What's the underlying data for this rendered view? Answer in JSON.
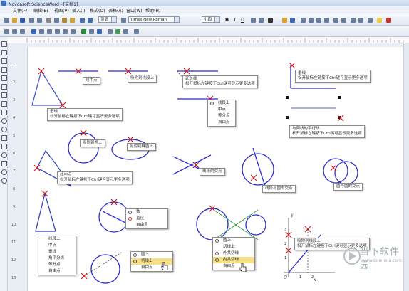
{
  "window": {
    "title": "Novoasoft ScienceWord - [文档1]"
  },
  "menubar": {
    "items": [
      "文件(F)",
      "编辑(E)",
      "视图(V)",
      "插入(I)",
      "格式(O)",
      "表格(A)",
      "窗口(W)",
      "帮助(H)"
    ]
  },
  "toolbar": {
    "style_combo": "页眉",
    "font_combo": "Times New Roman",
    "size_combo": "小四",
    "bold": "B",
    "italic": "I",
    "underline": "U"
  },
  "tooltips": {
    "line_midpoint": "线中点",
    "snap_to_line": "吸附到线段上",
    "extend_line": "延长线",
    "extend_line_hint": "松开鼠标左键按下Ctrl键可显示更多选项",
    "perpendicular": "垂线",
    "perpendicular_hint": "松开鼠标左键按下Ctrl键可显示更多选项",
    "vertical": "垂线",
    "vertical_hint": "松开鼠标左键按下Ctrl键可显示更多选项",
    "parallel": "与两线的平行线",
    "parallel_hint": "松开鼠标左键按下Ctrl键可显示更多选项",
    "snap_to_circle": "吸附到圆上",
    "snap_to_ellipse": "吸附到椭圆上",
    "segment_midpoint": "线中点",
    "segment_midpoint_hint": "松开鼠标左键按下Ctrl键可显示更多选项",
    "line_intersection": "线段的交点",
    "line_circle_intersection": "线段与圆的交点",
    "circle_circle_intersection": "圆与圆的交点",
    "snap_to_segment": "吸附到线段上",
    "snap_to_segment_hint": "松开鼠标左键按下Ctrl键可显示更多选项"
  },
  "menus": {
    "segment_menu": [
      "线段上",
      "中点",
      "等分点",
      "自由点"
    ],
    "circle_menu": [
      "弦",
      "直径",
      "自由点"
    ],
    "triangle_menu": [
      "线段上",
      "中点",
      "垂线",
      "角平分线",
      "等分点",
      "自由点"
    ],
    "tangent_menu": [
      "圆上",
      "切线上",
      "自由点"
    ],
    "two_circle_menu": [
      "圆上",
      "切线上",
      "外共切线",
      "内共切线",
      "自由点"
    ]
  },
  "axis": {
    "y_label": "y",
    "x_label": "x",
    "o_label": "O",
    "y_ticks": [
      "3",
      "2",
      "1"
    ],
    "x_ticks": [
      "1",
      "2"
    ]
  },
  "ruler": {
    "left_numbers": [
      "1",
      "2",
      "3",
      "4",
      "5",
      "6",
      "7",
      "8",
      "9",
      "10",
      "11",
      "12",
      "13"
    ]
  },
  "watermark": {
    "text": "当下软件园",
    "url": "www.downxia.com"
  },
  "colors": {
    "shape": "#2b2bd0",
    "cross": "#cc2222",
    "highlight": "#f7e28a",
    "tangent": "#2a9a3a"
  }
}
